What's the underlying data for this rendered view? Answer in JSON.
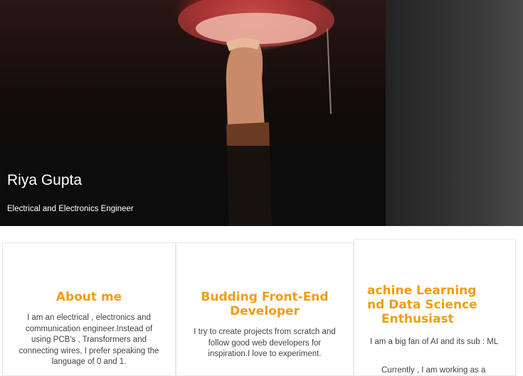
{
  "hero": {
    "name": "Riya Gupta",
    "subtitle": "Electrical and Electronics Engineer",
    "image_subject": "hand-releasing-sky-lantern-photo"
  },
  "cards": [
    {
      "title": "About me",
      "text": "I am an electrical , electronics and communication engineer.Instead of using PCB's , Transformers and connecting wires, I prefer speaking the language of 0 and 1."
    },
    {
      "title": "Budding Front-End Developer",
      "text": "I try to create projects from scratch and follow good web developers for inspiration.I love to experiment."
    },
    {
      "title_line1": "achine Learning",
      "title_line2": "nd Data Science",
      "title_line3": "Enthusiast",
      "text1": "I am a big fan of AI and its sub : ML",
      "text2": "Currently , I am working as a"
    }
  ],
  "colors": {
    "accent": "#f39c12",
    "hero_overlay": "#0c0c0c",
    "text": "#444444"
  }
}
